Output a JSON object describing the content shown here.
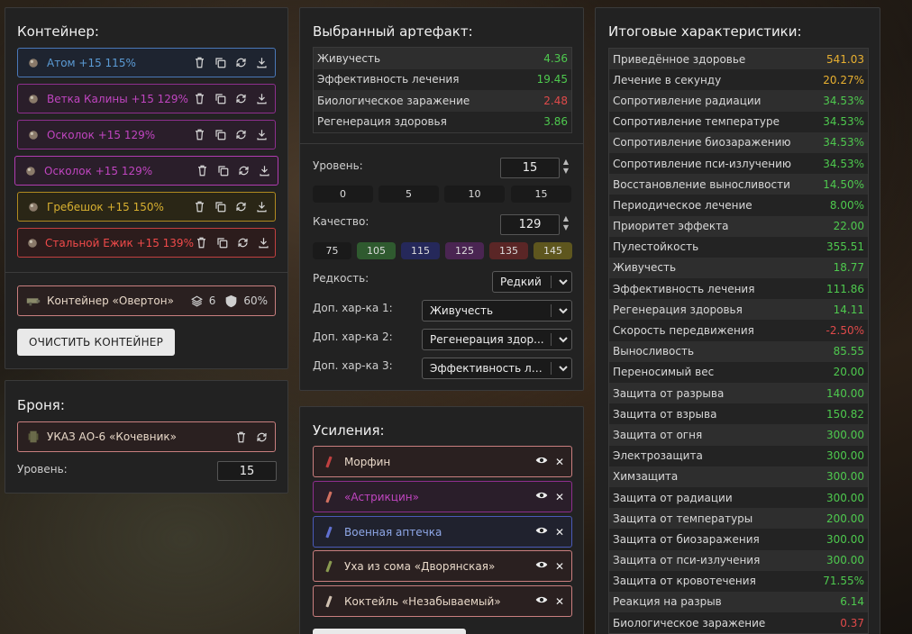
{
  "container": {
    "title": "Контейнер:",
    "artifacts": [
      {
        "name": "Атом +15 115%",
        "color": "#5b9bd5",
        "border": "#4a78b8",
        "bg": "#1e2430"
      },
      {
        "name": "Ветка Калины +15 129%",
        "color": "#c045c0",
        "border": "#8e2f8e",
        "bg": "#2a1e2a"
      },
      {
        "name": "Осколок +15 129%",
        "color": "#c045c0",
        "border": "#8e2f8e",
        "bg": "#2a1e2a"
      },
      {
        "name": "Осколок +15 129%",
        "color": "#c045c0",
        "border": "#b03cb0",
        "bg": "#2a1e2a"
      },
      {
        "name": "Гребешок +15 150%",
        "color": "#d8b030",
        "border": "#b08a20",
        "bg": "#2a2616"
      },
      {
        "name": "Стальной Ежик +15 139%",
        "color": "#f04a4a",
        "border": "#c24040",
        "bg": "#2c1c1c"
      }
    ],
    "container_item": {
      "name": "Контейнер «Овертон»",
      "slots": "6",
      "protection": "60%"
    },
    "clear_button": "ОЧИСТИТЬ КОНТЕЙНЕР"
  },
  "armor": {
    "title": "Броня:",
    "name": "УКАЗ АО-6 «Кочевник»",
    "level_label": "Уровень:",
    "level": "15"
  },
  "selected": {
    "title": "Выбранный артефакт:",
    "stats": [
      {
        "name": "Живучесть",
        "value": "4.36",
        "color": "#4ec94e"
      },
      {
        "name": "Эффективность лечения",
        "value": "19.45",
        "color": "#4ec94e"
      },
      {
        "name": "Биологическое заражение",
        "value": "2.48",
        "color": "#e04a4a"
      },
      {
        "name": "Регенерация здоровья",
        "value": "3.86",
        "color": "#4ec94e"
      }
    ],
    "level_label": "Уровень:",
    "level": "15",
    "level_presets": [
      "0",
      "5",
      "10",
      "15"
    ],
    "quality_label": "Качество:",
    "quality": "129",
    "quality_presets": [
      {
        "label": "75",
        "bg": "#1a1a1a"
      },
      {
        "label": "105",
        "bg": "#2f5a2f"
      },
      {
        "label": "115",
        "bg": "#25285a"
      },
      {
        "label": "125",
        "bg": "#4a2552"
      },
      {
        "label": "135",
        "bg": "#5a2626"
      },
      {
        "label": "145",
        "bg": "#5e561e"
      }
    ],
    "rarity_label": "Редкость:",
    "rarity": "Редкий",
    "extra1_label": "Доп. хар-ка 1:",
    "extra1": "Живучесть",
    "extra2_label": "Доп. хар-ка 2:",
    "extra2": "Регенерация здор...",
    "extra3_label": "Доп. хар-ка 3:",
    "extra3": "Эффективность ле..."
  },
  "boosts": {
    "title": "Усиления:",
    "items": [
      {
        "name": "Морфин",
        "color": "#e8d8c8",
        "border": "#c97f7f",
        "bg": "#2a2020",
        "icon_color": "#c04040"
      },
      {
        "name": "«Астрикцин»",
        "color": "#c045c0",
        "border": "#8e2f8e",
        "bg": "#2a1e2a",
        "icon_color": "#d07060"
      },
      {
        "name": "Военная аптечка",
        "color": "#8fa8e8",
        "border": "#4a5ab8",
        "bg": "#20222e",
        "icon_color": "#6070d0"
      },
      {
        "name": "Уха из сома «Дворянская»",
        "color": "#e8d8c8",
        "border": "#c97f7f",
        "bg": "#2a2020",
        "icon_color": "#8a9a50"
      },
      {
        "name": "Коктейль «Незабываемый»",
        "color": "#e8d8c8",
        "border": "#c97f7f",
        "bg": "#2a2020",
        "icon_color": "#d0c0b0"
      }
    ]
  },
  "totals": {
    "title": "Итоговые характеристики:",
    "rows": [
      {
        "name": "Приведённое здоровье",
        "value": "541.03",
        "color": "#e8b030"
      },
      {
        "name": "Лечение в секунду",
        "value": "20.27%",
        "color": "#e8b030"
      },
      {
        "name": "Сопротивление радиации",
        "value": "34.53%",
        "color": "#4ec94e"
      },
      {
        "name": "Сопротивление температуре",
        "value": "34.53%",
        "color": "#4ec94e"
      },
      {
        "name": "Сопротивление биозаражению",
        "value": "34.53%",
        "color": "#4ec94e"
      },
      {
        "name": "Сопротивление пси-излучению",
        "value": "34.53%",
        "color": "#4ec94e"
      },
      {
        "name": "Восстановление выносливости",
        "value": "14.50%",
        "color": "#4ec94e"
      },
      {
        "name": "Периодическое лечение",
        "value": "8.00%",
        "color": "#4ec94e"
      },
      {
        "name": "Приоритет эффекта",
        "value": "22.00",
        "color": "#4ec94e"
      },
      {
        "name": "Пулестойкость",
        "value": "355.51",
        "color": "#4ec94e"
      },
      {
        "name": "Живучесть",
        "value": "18.77",
        "color": "#4ec94e"
      },
      {
        "name": "Эффективность лечения",
        "value": "111.86",
        "color": "#4ec94e"
      },
      {
        "name": "Регенерация здоровья",
        "value": "14.11",
        "color": "#4ec94e"
      },
      {
        "name": "Скорость передвижения",
        "value": "-2.50%",
        "color": "#e04a4a"
      },
      {
        "name": "Выносливость",
        "value": "85.55",
        "color": "#4ec94e"
      },
      {
        "name": "Переносимый вес",
        "value": "20.00",
        "color": "#4ec94e"
      },
      {
        "name": "Защита от разрыва",
        "value": "140.00",
        "color": "#4ec94e"
      },
      {
        "name": "Защита от взрыва",
        "value": "150.82",
        "color": "#4ec94e"
      },
      {
        "name": "Защита от огня",
        "value": "300.00",
        "color": "#4ec94e"
      },
      {
        "name": "Электрозащита",
        "value": "300.00",
        "color": "#4ec94e"
      },
      {
        "name": "Химзащита",
        "value": "300.00",
        "color": "#4ec94e"
      },
      {
        "name": "Защита от радиации",
        "value": "300.00",
        "color": "#4ec94e"
      },
      {
        "name": "Защита от температуры",
        "value": "200.00",
        "color": "#4ec94e"
      },
      {
        "name": "Защита от биозаражения",
        "value": "300.00",
        "color": "#4ec94e"
      },
      {
        "name": "Защита от пси-излучения",
        "value": "300.00",
        "color": "#4ec94e"
      },
      {
        "name": "Защита от кровотечения",
        "value": "71.55%",
        "color": "#4ec94e"
      },
      {
        "name": "Реакция на разрыв",
        "value": "6.14",
        "color": "#4ec94e"
      },
      {
        "name": "Биологическое заражение",
        "value": "0.37",
        "color": "#e04a4a"
      }
    ]
  }
}
